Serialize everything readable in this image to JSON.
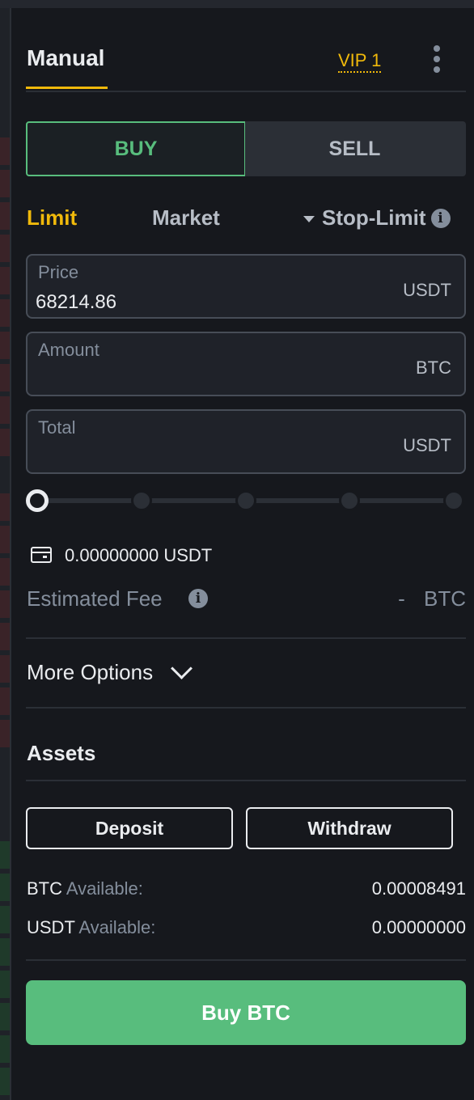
{
  "header": {
    "tab_label": "Manual",
    "vip_label": "VIP 1",
    "more_icon": "more-vertical-icon"
  },
  "side": {
    "buy_label": "BUY",
    "sell_label": "SELL",
    "selected": "BUY"
  },
  "order_types": {
    "limit": "Limit",
    "market": "Market",
    "stop_limit": "Stop-Limit",
    "selected": "Limit",
    "info_glyph": "i"
  },
  "fields": {
    "price": {
      "label": "Price",
      "value": "68214.86",
      "unit": "USDT"
    },
    "amount": {
      "label": "Amount",
      "value": "",
      "unit": "BTC"
    },
    "total": {
      "label": "Total",
      "value": "",
      "unit": "USDT"
    }
  },
  "slider": {
    "level_percent": 0,
    "stops": [
      0,
      25,
      50,
      75,
      100
    ]
  },
  "wallet": {
    "balance": "0.00000000 USDT",
    "icon": "wallet-icon"
  },
  "fee": {
    "label": "Estimated Fee",
    "dash": "-",
    "unit": "BTC",
    "info_glyph": "i"
  },
  "more_options": {
    "label": "More Options",
    "icon": "chevron-down-icon"
  },
  "assets": {
    "title": "Assets",
    "deposit_label": "Deposit",
    "withdraw_label": "Withdraw",
    "rows": [
      {
        "currency": "BTC",
        "label": "Available:",
        "value": "0.00008491"
      },
      {
        "currency": "USDT",
        "label": "Available:",
        "value": "0.00000000"
      }
    ]
  },
  "submit": {
    "label": "Buy BTC"
  },
  "colors": {
    "background": "#16181d",
    "accent_yellow": "#f0b90b",
    "buy_green": "#58bd7d",
    "muted_text": "#848e9c"
  }
}
